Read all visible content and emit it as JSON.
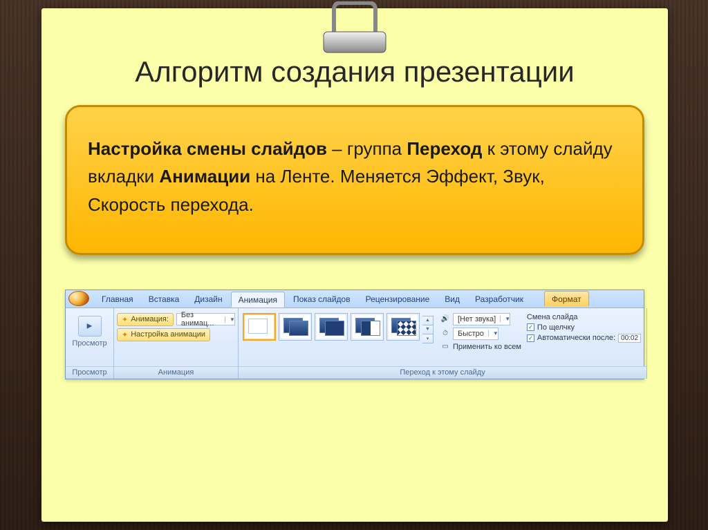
{
  "title": "Алгоритм создания презентации",
  "callout": {
    "bold1": "Настройка смены слайдов",
    "mid1": " – группа ",
    "bold2": "Переход",
    "mid2": " к этому слайду вкладки ",
    "bold3": "Анимации",
    "tail": " на Ленте. Меняется Эффект, Звук, Скорость перехода."
  },
  "ribbon": {
    "tabs": {
      "home": "Главная",
      "insert": "Вставка",
      "design": "Дизайн",
      "animation": "Анимация",
      "slideshow": "Показ слайдов",
      "review": "Рецензирование",
      "view": "Вид",
      "developer": "Разработчик",
      "format": "Формат"
    },
    "group1": {
      "preview": "Просмотр",
      "label": "Просмотр"
    },
    "group2": {
      "anim_lbl": "Анимация:",
      "anim_val": "Без анимац...",
      "custom_btn": "Настройка анимации",
      "label": "Анимация"
    },
    "group3": {
      "label": "Переход к этому слайду",
      "sound_lbl": "[Нет звука]",
      "speed_lbl": "Быстро",
      "apply_all": "Применить ко всем",
      "advance_title": "Смена слайда",
      "on_click": "По щелчку",
      "auto_after": "Автоматически после:",
      "time": "00:02"
    }
  }
}
